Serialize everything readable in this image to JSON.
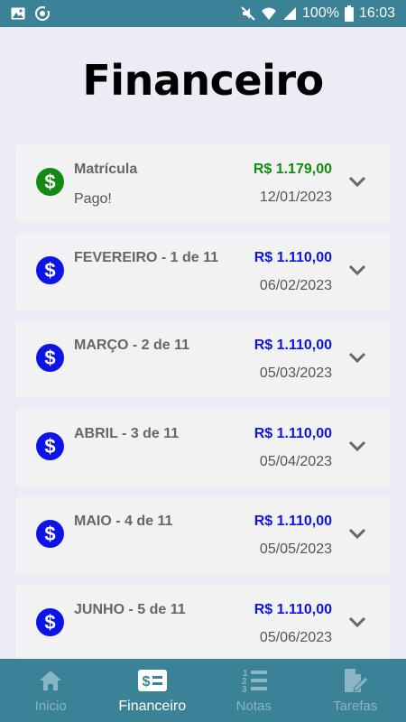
{
  "status_bar": {
    "battery": "100%",
    "time": "16:03"
  },
  "page": {
    "title": "Financeiro"
  },
  "colors": {
    "header": "#3b8296",
    "paid": "#138a13",
    "pending": "#0d14e8",
    "nav_inactive": "#8ab5c2",
    "nav_active": "#ffffff"
  },
  "payments": [
    {
      "name": "Matrícula",
      "status": "Pago!",
      "amount": "R$ 1.179,00",
      "date": "12/01/2023",
      "paid": true,
      "icon": "dollar-icon",
      "expand_icon": "chevron-down-icon"
    },
    {
      "name": "FEVEREIRO - 1 de 11",
      "status": "",
      "amount": "R$ 1.110,00",
      "date": "06/02/2023",
      "paid": false,
      "icon": "dollar-icon",
      "expand_icon": "chevron-down-icon"
    },
    {
      "name": "MARÇO - 2 de 11",
      "status": "",
      "amount": "R$ 1.110,00",
      "date": "05/03/2023",
      "paid": false,
      "icon": "dollar-icon",
      "expand_icon": "chevron-down-icon"
    },
    {
      "name": "ABRIL - 3 de 11",
      "status": "",
      "amount": "R$ 1.110,00",
      "date": "05/04/2023",
      "paid": false,
      "icon": "dollar-icon",
      "expand_icon": "chevron-down-icon"
    },
    {
      "name": "MAIO - 4 de 11",
      "status": "",
      "amount": "R$ 1.110,00",
      "date": "05/05/2023",
      "paid": false,
      "icon": "dollar-icon",
      "expand_icon": "chevron-down-icon"
    },
    {
      "name": "JUNHO - 5 de 11",
      "status": "",
      "amount": "R$ 1.110,00",
      "date": "05/06/2023",
      "paid": false,
      "icon": "dollar-icon",
      "expand_icon": "chevron-down-icon"
    }
  ],
  "nav": [
    {
      "label": "Inicio",
      "icon": "home-icon",
      "active": false
    },
    {
      "label": "Financeiro",
      "icon": "money-bill-icon",
      "active": true
    },
    {
      "label": "Notas",
      "icon": "numbered-list-icon",
      "active": false
    },
    {
      "label": "Tarefas",
      "icon": "file-edit-icon",
      "active": false
    }
  ]
}
